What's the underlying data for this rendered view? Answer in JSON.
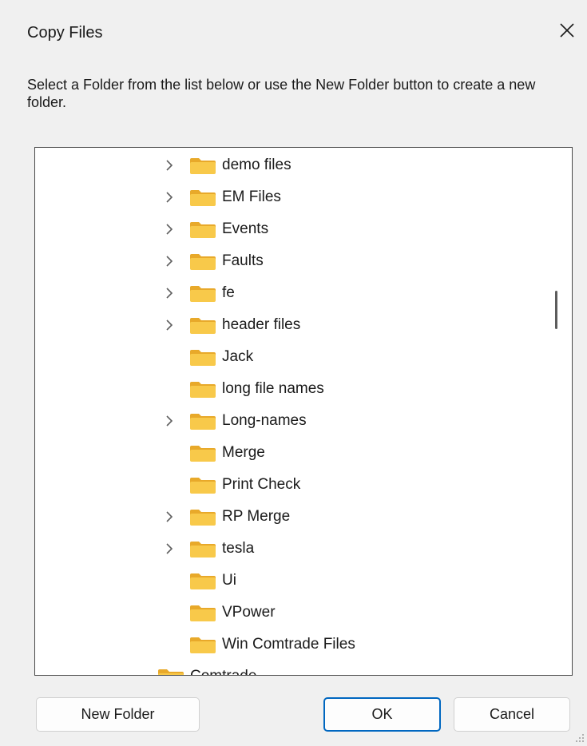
{
  "window": {
    "title": "Copy Files",
    "close_icon": "close-icon"
  },
  "instructions": "Select a Folder from the list below or use the New Folder button to create a new folder.",
  "tree": {
    "items": [
      {
        "label": "demo files",
        "expandable": true
      },
      {
        "label": "EM Files",
        "expandable": true
      },
      {
        "label": "Events",
        "expandable": true
      },
      {
        "label": "Faults",
        "expandable": true
      },
      {
        "label": "fe",
        "expandable": true
      },
      {
        "label": "header files",
        "expandable": true
      },
      {
        "label": "Jack",
        "expandable": false
      },
      {
        "label": "long file names",
        "expandable": false
      },
      {
        "label": "Long-names",
        "expandable": true
      },
      {
        "label": "Merge",
        "expandable": false
      },
      {
        "label": "Print Check",
        "expandable": false
      },
      {
        "label": "RP Merge",
        "expandable": true
      },
      {
        "label": "tesla",
        "expandable": true
      },
      {
        "label": "Ui",
        "expandable": false
      },
      {
        "label": "VPower",
        "expandable": false
      },
      {
        "label": "Win Comtrade Files",
        "expandable": false
      }
    ],
    "partial_item": {
      "label": "Comtrade"
    }
  },
  "buttons": {
    "new_folder": "New Folder",
    "ok": "OK",
    "cancel": "Cancel"
  },
  "colors": {
    "folder_fill": "#f8c94a",
    "folder_tab": "#e8a92a",
    "accent": "#0067c0"
  }
}
